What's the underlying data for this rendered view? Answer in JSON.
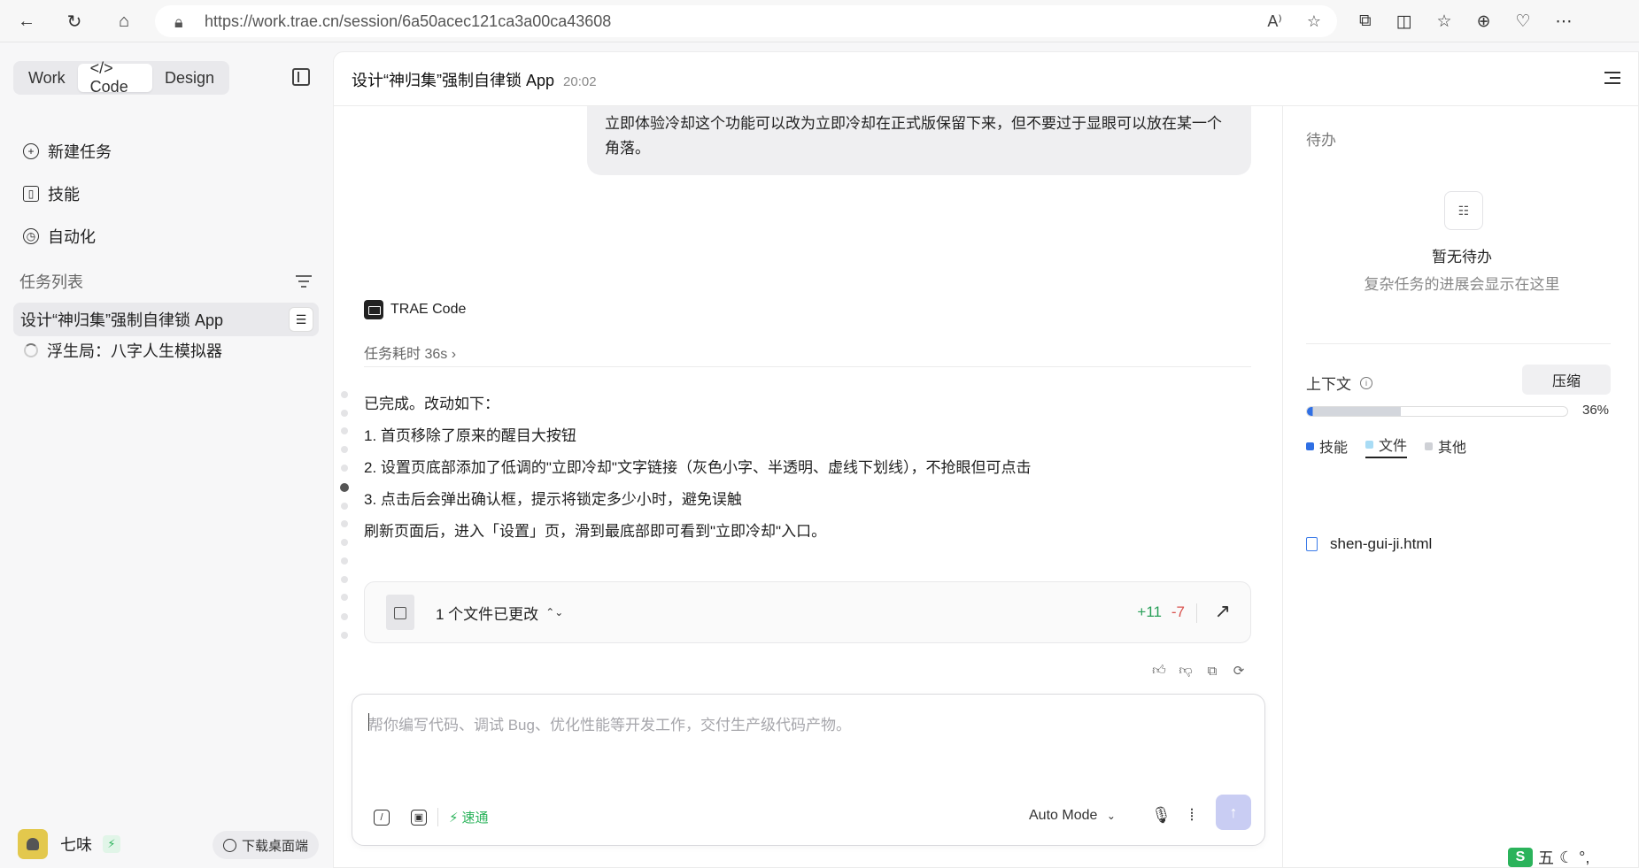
{
  "browser": {
    "url": "https://work.trae.cn/session/6a50acec121ca3a00ca43608",
    "nav_icons": [
      "back-arrow-icon",
      "refresh-icon",
      "home-icon"
    ],
    "address_icons": [
      "read-aloud-icon",
      "favorite-star-icon"
    ],
    "toolbar_icons": [
      "extensions-icon",
      "split-screen-icon",
      "favorites-icon",
      "collections-icon",
      "performance-icon",
      "more-icon"
    ]
  },
  "sidebar": {
    "modes": [
      {
        "label": "Work",
        "active": false
      },
      {
        "label": "</> Code",
        "active": true
      },
      {
        "label": "Design",
        "active": false
      }
    ],
    "menu": [
      {
        "label": "新建任务",
        "icon": "plus-circle-icon"
      },
      {
        "label": "技能",
        "icon": "book-icon"
      },
      {
        "label": "自动化",
        "icon": "clock-icon"
      }
    ],
    "tasks_title": "任务列表",
    "tasks": [
      {
        "label": "设计“神归集”强制自律锁 App",
        "active": true
      },
      {
        "label": "浮生局：八字人生模拟器",
        "active": false
      }
    ],
    "user_name": "七味",
    "download_label": "下载桌面端"
  },
  "main": {
    "title": "设计“神归集”强制自律锁 App",
    "time": "20:02",
    "user_message": "立即体验冷却这个功能可以改为立即冷却在正式版保留下来，但不要过于显眼可以放在某一个角落。",
    "assistant_name": "TRAE Code",
    "duration": "任务耗时 36s ›",
    "answer_intro": "已完成。改动如下：",
    "answer_items": [
      "1. 首页移除了原来的醒目大按钮",
      "2. 设置页底部添加了低调的\"立即冷却\"文字链接（灰色小字、半透明、虚线下划线），不抢眼但可点击",
      "3. 点击后会弹出确认框，提示将锁定多少小时，避免误触"
    ],
    "answer_outro": "刷新页面后，进入「设置」页，滑到最底部即可看到\"立即冷却\"入口。",
    "file_change_label": "1 个文件已更改",
    "additions": "+11",
    "deletions": "-7"
  },
  "composer": {
    "placeholder": "帮你编写代码、调试 Bug、优化性能等开发工作，交付生产级代码产物。",
    "speed_label": "速通",
    "mode_label": "Auto Mode"
  },
  "right_panel": {
    "todo_title": "待办",
    "todo_empty": "暂无待办",
    "todo_desc": "复杂任务的进展会显示在这里",
    "context_title": "上下文",
    "compress_label": "压缩",
    "context_percent": "36%",
    "context_fraction": 0.36,
    "legend": [
      {
        "label": "技能",
        "color": "#2f6fe4",
        "active": false
      },
      {
        "label": "文件",
        "color": "#a9dcf5",
        "active": true
      },
      {
        "label": "其他",
        "color": "#cfd1d6",
        "active": false
      }
    ],
    "file_name": "shen-gui-ji.html"
  },
  "tray": {
    "ime_label": "五"
  }
}
